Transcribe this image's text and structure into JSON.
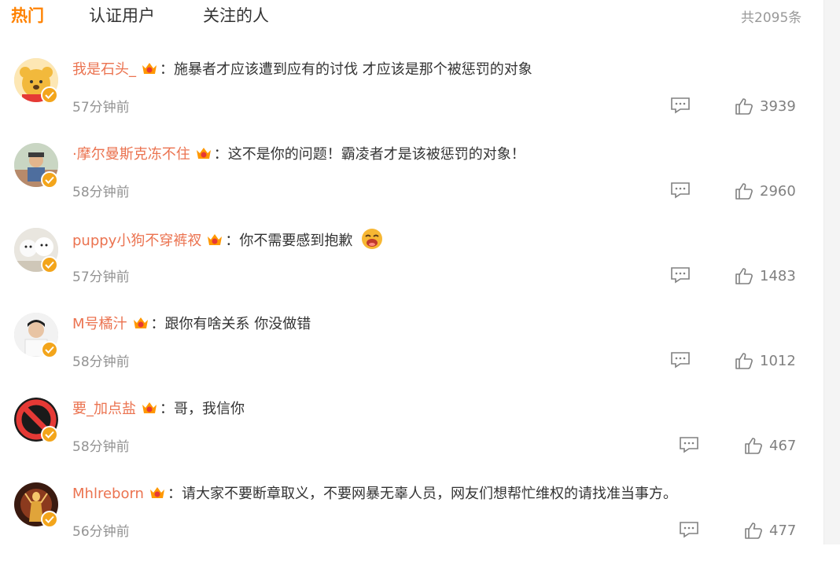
{
  "tabs": [
    {
      "label": "热门",
      "active": true
    },
    {
      "label": "认证用户",
      "active": false
    },
    {
      "label": "关注的人",
      "active": false
    }
  ],
  "total": "共2095条",
  "colors": {
    "accent": "#ff8200",
    "username": "#eb7350",
    "muted": "#939393",
    "badge": "#f3a51b"
  },
  "comments": [
    {
      "username": "我是石头_",
      "sep": "：",
      "text": "施暴者才应该遭到应有的讨伐 才应该是那个被惩罚的对象",
      "time": "57分钟前",
      "likes": "3939",
      "avatar": "cartoon-bear-avatar"
    },
    {
      "username": "·摩尔曼斯克冻不住",
      "sep": "：",
      "text": "这不是你的问题！霸凌者才是该被惩罚的对象！",
      "time": "58分钟前",
      "likes": "2960",
      "avatar": "photo-avatar"
    },
    {
      "username": "puppy小狗不穿裤衩",
      "sep": "：",
      "text": "你不需要感到抱歉",
      "time": "57分钟前",
      "likes": "1483",
      "avatar": "white-dogs-avatar",
      "emoji": "crying-face-emoji"
    },
    {
      "username": "M号橘汁",
      "sep": "：",
      "text": "跟你有啥关系 你没做错",
      "time": "58分钟前",
      "likes": "1012",
      "avatar": "photo-avatar"
    },
    {
      "username": "要_加点盐",
      "sep": "：",
      "text": "哥，我信你",
      "time": "58分钟前",
      "likes": "467",
      "avatar": "prohibited-sign-avatar"
    },
    {
      "username": "Mhlreborn",
      "sep": "：",
      "text": "请大家不要断章取义，不要网暴无辜人员，网友们想帮忙维权的请找准当事方。",
      "time": "56分钟前",
      "likes": "477",
      "avatar": "golden-figure-avatar"
    }
  ]
}
